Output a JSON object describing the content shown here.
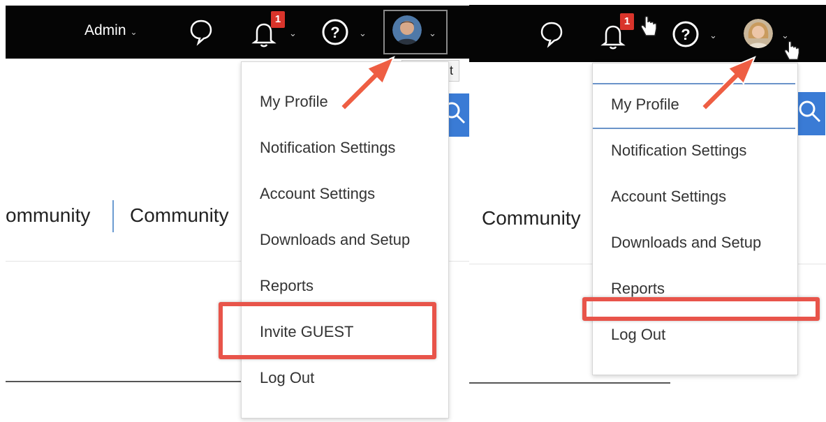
{
  "left": {
    "admin_label": "Admin",
    "notification_count": "1",
    "tooltip": "Account",
    "community_partial": "ommunity",
    "community": "Community",
    "menu": [
      "My Profile",
      "Notification Settings",
      "Account Settings",
      "Downloads and Setup",
      "Reports",
      "Invite GUEST",
      "Log Out"
    ]
  },
  "right": {
    "notification_count": "1",
    "community": "Community",
    "menu": [
      "My Profile",
      "Notification Settings",
      "Account Settings",
      "Downloads and Setup",
      "Reports",
      "Log Out"
    ]
  },
  "colors": {
    "topbar": "#050505",
    "badge": "#d9342b",
    "highlight": "#e8544a",
    "search": "#3a7bd5",
    "focus_border": "#6a93c9"
  },
  "icons": [
    "chat-bubble-icon",
    "bell-icon",
    "help-icon",
    "chevron-down-icon",
    "avatar",
    "search-icon",
    "arrow-annotation",
    "hand-cursor-icon"
  ]
}
